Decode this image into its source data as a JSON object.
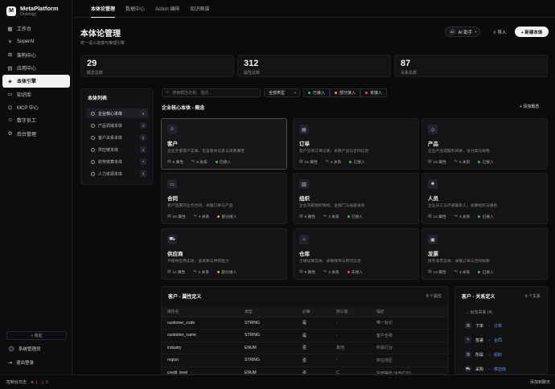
{
  "brand": {
    "logo": "M",
    "title": "MetaPlatform",
    "subtitle": "Ontology"
  },
  "sidebar": {
    "items": [
      {
        "label": "工作台",
        "icon": "grid-icon",
        "glyph": "▦"
      },
      {
        "label": "SuperAI",
        "icon": "sparkle-icon",
        "glyph": "✳"
      },
      {
        "label": "架构中心",
        "icon": "hierarchy-icon",
        "glyph": "⊞"
      },
      {
        "label": "应用中心",
        "icon": "apps-icon",
        "glyph": "▤"
      },
      {
        "label": "本体引擎",
        "icon": "engine-icon",
        "glyph": "◈"
      },
      {
        "label": "知识库",
        "icon": "book-icon",
        "glyph": "▭"
      },
      {
        "label": "MCP 中心",
        "icon": "plug-icon",
        "glyph": "⌬"
      },
      {
        "label": "数字员工",
        "icon": "robot-icon",
        "glyph": "☺"
      },
      {
        "label": "后台管理",
        "icon": "admin-icon",
        "glyph": "⚙"
      }
    ],
    "active_index": 4,
    "collapse_label": "« 收起",
    "user_name": "系统管理员",
    "user_glyph": "◯",
    "logout_label": "退出登录",
    "logout_glyph": "⇥"
  },
  "topnav": {
    "tabs": [
      "本体论管理",
      "数据中心",
      "Action 编排",
      "知识图谱"
    ],
    "active": 0
  },
  "header": {
    "title": "本体论管理",
    "subtitle": "统一语义建模与推理引擎",
    "ai_badge": "AI",
    "ai_label": "AI 助手",
    "ai_chevron": "▾",
    "import_label": "⇩ 导入",
    "new_label": "+ 新建本体"
  },
  "stats": [
    {
      "value": "29",
      "label": "概念总数"
    },
    {
      "value": "312",
      "label": "属性总数"
    },
    {
      "value": "87",
      "label": "关系总数"
    }
  ],
  "ontology_list": {
    "title": "本体列表",
    "items": [
      {
        "label": "企业核心本体",
        "count": "6"
      },
      {
        "label": "产品领域本体",
        "count": "4"
      },
      {
        "label": "客户关系本体",
        "count": "5"
      },
      {
        "label": "供应链本体",
        "count": "4"
      },
      {
        "label": "财务核算本体",
        "count": "7"
      },
      {
        "label": "人力资源本体",
        "count": "3"
      }
    ],
    "active_index": 0
  },
  "filters": {
    "search_placeholder": "搜索概念名称、描述...",
    "search_glyph": "⌕",
    "type_select": "全部类型",
    "select_chevron": "▾",
    "chips": [
      {
        "label": "已接入",
        "color": "#4fae62"
      },
      {
        "label": "部分接入",
        "color": "#d9a33a"
      },
      {
        "label": "未接入",
        "color": "#d65454"
      }
    ]
  },
  "concepts_section": {
    "title": "企业核心本体 - 概念",
    "add_label": "+ 添加概念"
  },
  "concepts": [
    {
      "name": "客户",
      "icon": "person-icon",
      "glyph": "☺",
      "desc": "企业外部客户实体，包含基本信息与资质属性",
      "attrs": "8 属性",
      "rels": "6 关系",
      "status": "已接入",
      "status_color": "#4fae62"
    },
    {
      "name": "订单",
      "icon": "document-icon",
      "glyph": "▤",
      "desc": "客户交易订单记录，关联产品与合同信息",
      "attrs": "15 属性",
      "rels": "3 关系",
      "status": "已接入",
      "status_color": "#4fae62"
    },
    {
      "name": "产品",
      "icon": "box-icon",
      "glyph": "◇",
      "desc": "企业产品或服务目录，含分类与规格",
      "attrs": "18 属性",
      "rels": "5 关系",
      "status": "已接入",
      "status_color": "#4fae62"
    },
    {
      "name": "合同",
      "icon": "file-icon",
      "glyph": "▭",
      "desc": "客户签署的业务合同，关联订单与产品",
      "attrs": "20 属性",
      "rels": "4 关系",
      "status": "部分接入",
      "status_color": "#d9a33a"
    },
    {
      "name": "组织",
      "icon": "building-icon",
      "glyph": "▥",
      "desc": "企业内部组织架构，含部门与层级关系",
      "attrs": "8 属性",
      "rels": "2 关系",
      "status": "已接入",
      "status_color": "#4fae62"
    },
    {
      "name": "人员",
      "icon": "people-icon",
      "glyph": "☻",
      "desc": "企业员工与外部联系人，关联组织与角色",
      "attrs": "14 属性",
      "rels": "3 关系",
      "status": "已接入",
      "status_color": "#4fae62"
    },
    {
      "name": "供应商",
      "icon": "truck-icon",
      "glyph": "⛟",
      "desc": "外部供应商实体，含资质与供货能力",
      "attrs": "11 属性",
      "rels": "2 关系",
      "status": "部分接入",
      "status_color": "#d9a33a"
    },
    {
      "name": "仓库",
      "icon": "warehouse-icon",
      "glyph": "⌂",
      "desc": "仓储设施实体，关联库存与物流信息",
      "attrs": "9 属性",
      "rels": "3 关系",
      "status": "未接入",
      "status_color": "#d65454"
    },
    {
      "name": "发票",
      "icon": "invoice-icon",
      "glyph": "▣",
      "desc": "财务发票实体，关联订单与合同收款",
      "attrs": "13 属性",
      "rels": "3 关系",
      "status": "已接入",
      "status_color": "#4fae62"
    }
  ],
  "attributes": {
    "title": "客户 - 属性定义",
    "count": "8 个属性",
    "columns": [
      "属性名",
      "类型",
      "必填",
      "默认值",
      "描述"
    ],
    "rows": [
      {
        "name": "customer_code",
        "type": "STRING",
        "required": "是",
        "default": "-",
        "desc": "唯一标识"
      },
      {
        "name": "customer_name",
        "type": "STRING",
        "required": "是",
        "default": "-",
        "desc": "客户全称"
      },
      {
        "name": "industry",
        "type": "ENUM",
        "required": "否",
        "default": "其他",
        "desc": "所属行业"
      },
      {
        "name": "region",
        "type": "STRING",
        "required": "否",
        "default": "-",
        "desc": "所在地区"
      },
      {
        "name": "credit_level",
        "type": "ENUM",
        "required": "否",
        "default": "C",
        "desc": "信用等级 (A/B/C/D)"
      }
    ]
  },
  "relations": {
    "title": "客户 - 关系定义",
    "count": "6 个关系",
    "outgoing_label": "→ 出向关系 (4)",
    "items": [
      {
        "verb": "下单",
        "target": "订单",
        "icon": "document-icon",
        "glyph": "▤"
      },
      {
        "verb": "签署",
        "target": "合同",
        "icon": "sign-icon",
        "glyph": "✎"
      },
      {
        "verb": "所属",
        "target": "组织",
        "icon": "building-icon",
        "glyph": "▥"
      },
      {
        "verb": "采购",
        "target": "供应商",
        "icon": "cart-icon",
        "glyph": "⛟"
      }
    ]
  },
  "statusbar": {
    "console_label": "控制台日志",
    "error_glyph": "⊗",
    "error_count": "1",
    "warning_glyph": "△",
    "warning_count": "0",
    "right_label": "添加到聊天"
  }
}
